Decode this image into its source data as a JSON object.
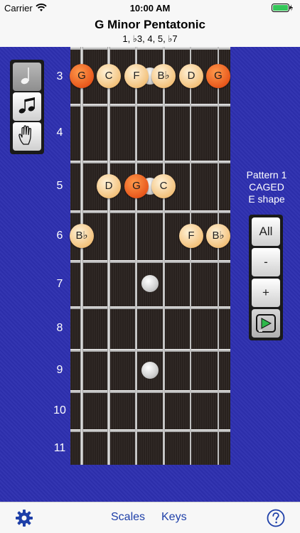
{
  "status": {
    "carrier": "Carrier",
    "time": "10:00 AM"
  },
  "nav": {
    "title": "G Minor Pentatonic",
    "formula": "1, ♭3, 4, 5, ♭7"
  },
  "fret_numbers": [
    "3",
    "4",
    "5",
    "6",
    "7",
    "8",
    "9",
    "10",
    "11"
  ],
  "notes": {
    "fret3": [
      "G",
      "C",
      "F",
      "B♭",
      "D",
      "G"
    ],
    "fret5": [
      "D",
      "G",
      "C"
    ],
    "fret6": [
      "B♭",
      "F",
      "B♭"
    ]
  },
  "pattern": {
    "line1": "Pattern 1",
    "line2": "CAGED",
    "line3": "E shape"
  },
  "controls": {
    "all_label": "All",
    "minus_label": "-",
    "plus_label": "+"
  },
  "tabbar": {
    "scales_label": "Scales",
    "keys_label": "Keys"
  },
  "icons": {
    "wifi": "wifi-icon",
    "battery": "battery-icon",
    "mode_note": "single-note-icon",
    "mode_notes": "beamed-notes-icon",
    "mode_hand": "hand-icon",
    "play": "play-icon",
    "settings": "gear-icon",
    "help": "help-icon"
  },
  "colors": {
    "background_blue": "#2d2fb0",
    "root_note": "#e8581c",
    "scale_note": "#f3c27d",
    "tab_link": "#1e3fa8"
  }
}
